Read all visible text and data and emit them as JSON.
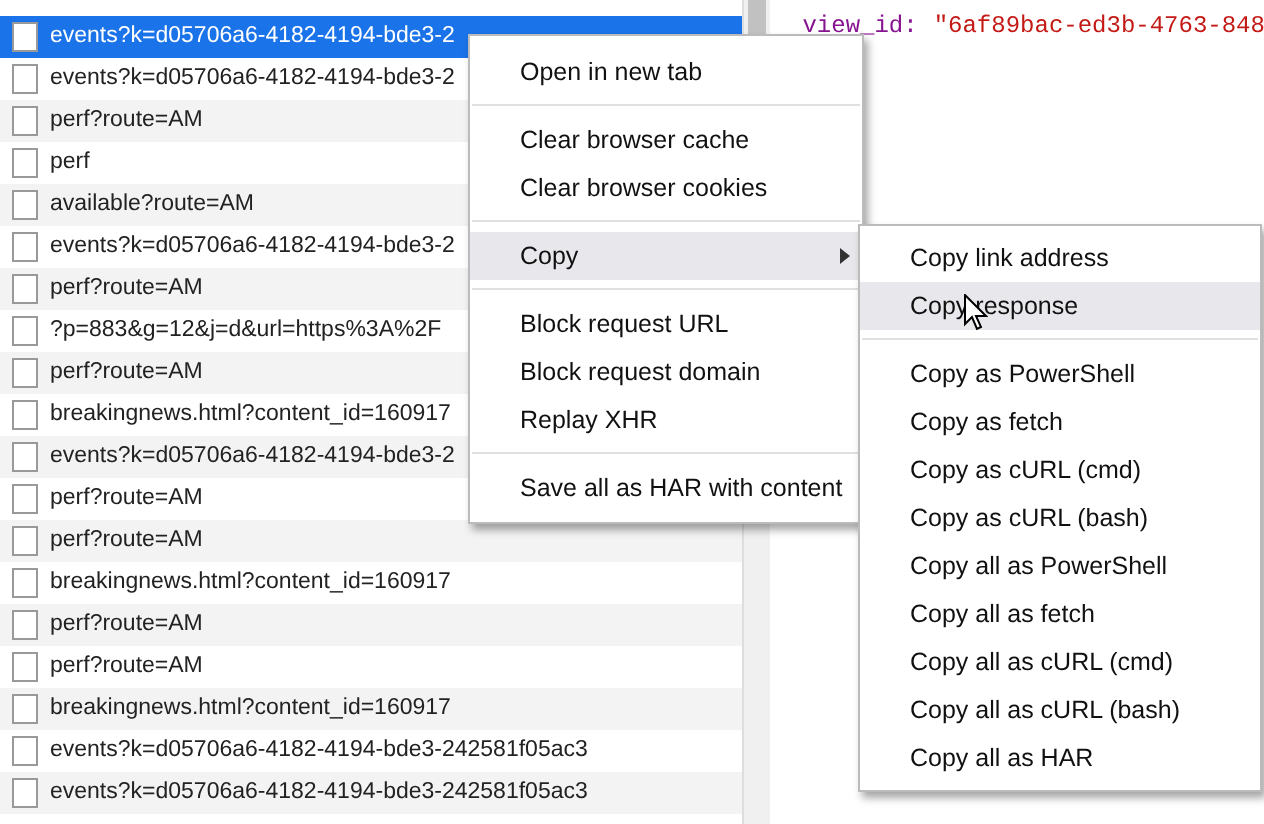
{
  "requests": [
    {
      "name": "events?k=d05706a6-4182-4194-bde3-2",
      "selected": true
    },
    {
      "name": "events?k=d05706a6-4182-4194-bde3-2",
      "selected": false
    },
    {
      "name": "perf?route=AM",
      "selected": false
    },
    {
      "name": "perf",
      "selected": false
    },
    {
      "name": "available?route=AM",
      "selected": false
    },
    {
      "name": "events?k=d05706a6-4182-4194-bde3-2",
      "selected": false
    },
    {
      "name": "perf?route=AM",
      "selected": false
    },
    {
      "name": "?p=883&g=12&j=d&url=https%3A%2F",
      "selected": false
    },
    {
      "name": "perf?route=AM",
      "selected": false
    },
    {
      "name": "breakingnews.html?content_id=160917",
      "selected": false
    },
    {
      "name": "events?k=d05706a6-4182-4194-bde3-2",
      "selected": false
    },
    {
      "name": "perf?route=AM",
      "selected": false
    },
    {
      "name": "perf?route=AM",
      "selected": false
    },
    {
      "name": "breakingnews.html?content_id=160917",
      "selected": false
    },
    {
      "name": "perf?route=AM",
      "selected": false
    },
    {
      "name": "perf?route=AM",
      "selected": false
    },
    {
      "name": "breakingnews.html?content_id=160917",
      "selected": false
    },
    {
      "name": "events?k=d05706a6-4182-4194-bde3-242581f05ac3",
      "selected": false
    },
    {
      "name": "events?k=d05706a6-4182-4194-bde3-242581f05ac3",
      "selected": false
    }
  ],
  "preview": {
    "lines": [
      {
        "key": "view_id:",
        "value": "\"6af89bac-ed3b-4763-848"
      }
    ]
  },
  "context_menu": {
    "items": [
      {
        "kind": "item",
        "label": "Open in new tab",
        "selected": false,
        "has_submenu": false
      },
      {
        "kind": "separator"
      },
      {
        "kind": "item",
        "label": "Clear browser cache",
        "selected": false,
        "has_submenu": false
      },
      {
        "kind": "item",
        "label": "Clear browser cookies",
        "selected": false,
        "has_submenu": false
      },
      {
        "kind": "separator"
      },
      {
        "kind": "item",
        "label": "Copy",
        "selected": true,
        "has_submenu": true
      },
      {
        "kind": "separator"
      },
      {
        "kind": "item",
        "label": "Block request URL",
        "selected": false,
        "has_submenu": false
      },
      {
        "kind": "item",
        "label": "Block request domain",
        "selected": false,
        "has_submenu": false
      },
      {
        "kind": "item",
        "label": "Replay XHR",
        "selected": false,
        "has_submenu": false
      },
      {
        "kind": "separator"
      },
      {
        "kind": "item",
        "label": "Save all as HAR with content",
        "selected": false,
        "has_submenu": false
      }
    ]
  },
  "submenu": {
    "items": [
      {
        "kind": "item",
        "label": "Copy link address",
        "selected": false
      },
      {
        "kind": "item",
        "label": "Copy response",
        "selected": true
      },
      {
        "kind": "separator"
      },
      {
        "kind": "item",
        "label": "Copy as PowerShell",
        "selected": false
      },
      {
        "kind": "item",
        "label": "Copy as fetch",
        "selected": false
      },
      {
        "kind": "item",
        "label": "Copy as cURL (cmd)",
        "selected": false
      },
      {
        "kind": "item",
        "label": "Copy as cURL (bash)",
        "selected": false
      },
      {
        "kind": "item",
        "label": "Copy all as PowerShell",
        "selected": false
      },
      {
        "kind": "item",
        "label": "Copy all as fetch",
        "selected": false
      },
      {
        "kind": "item",
        "label": "Copy all as cURL (cmd)",
        "selected": false
      },
      {
        "kind": "item",
        "label": "Copy all as cURL (bash)",
        "selected": false
      },
      {
        "kind": "item",
        "label": "Copy all as HAR",
        "selected": false
      }
    ]
  }
}
